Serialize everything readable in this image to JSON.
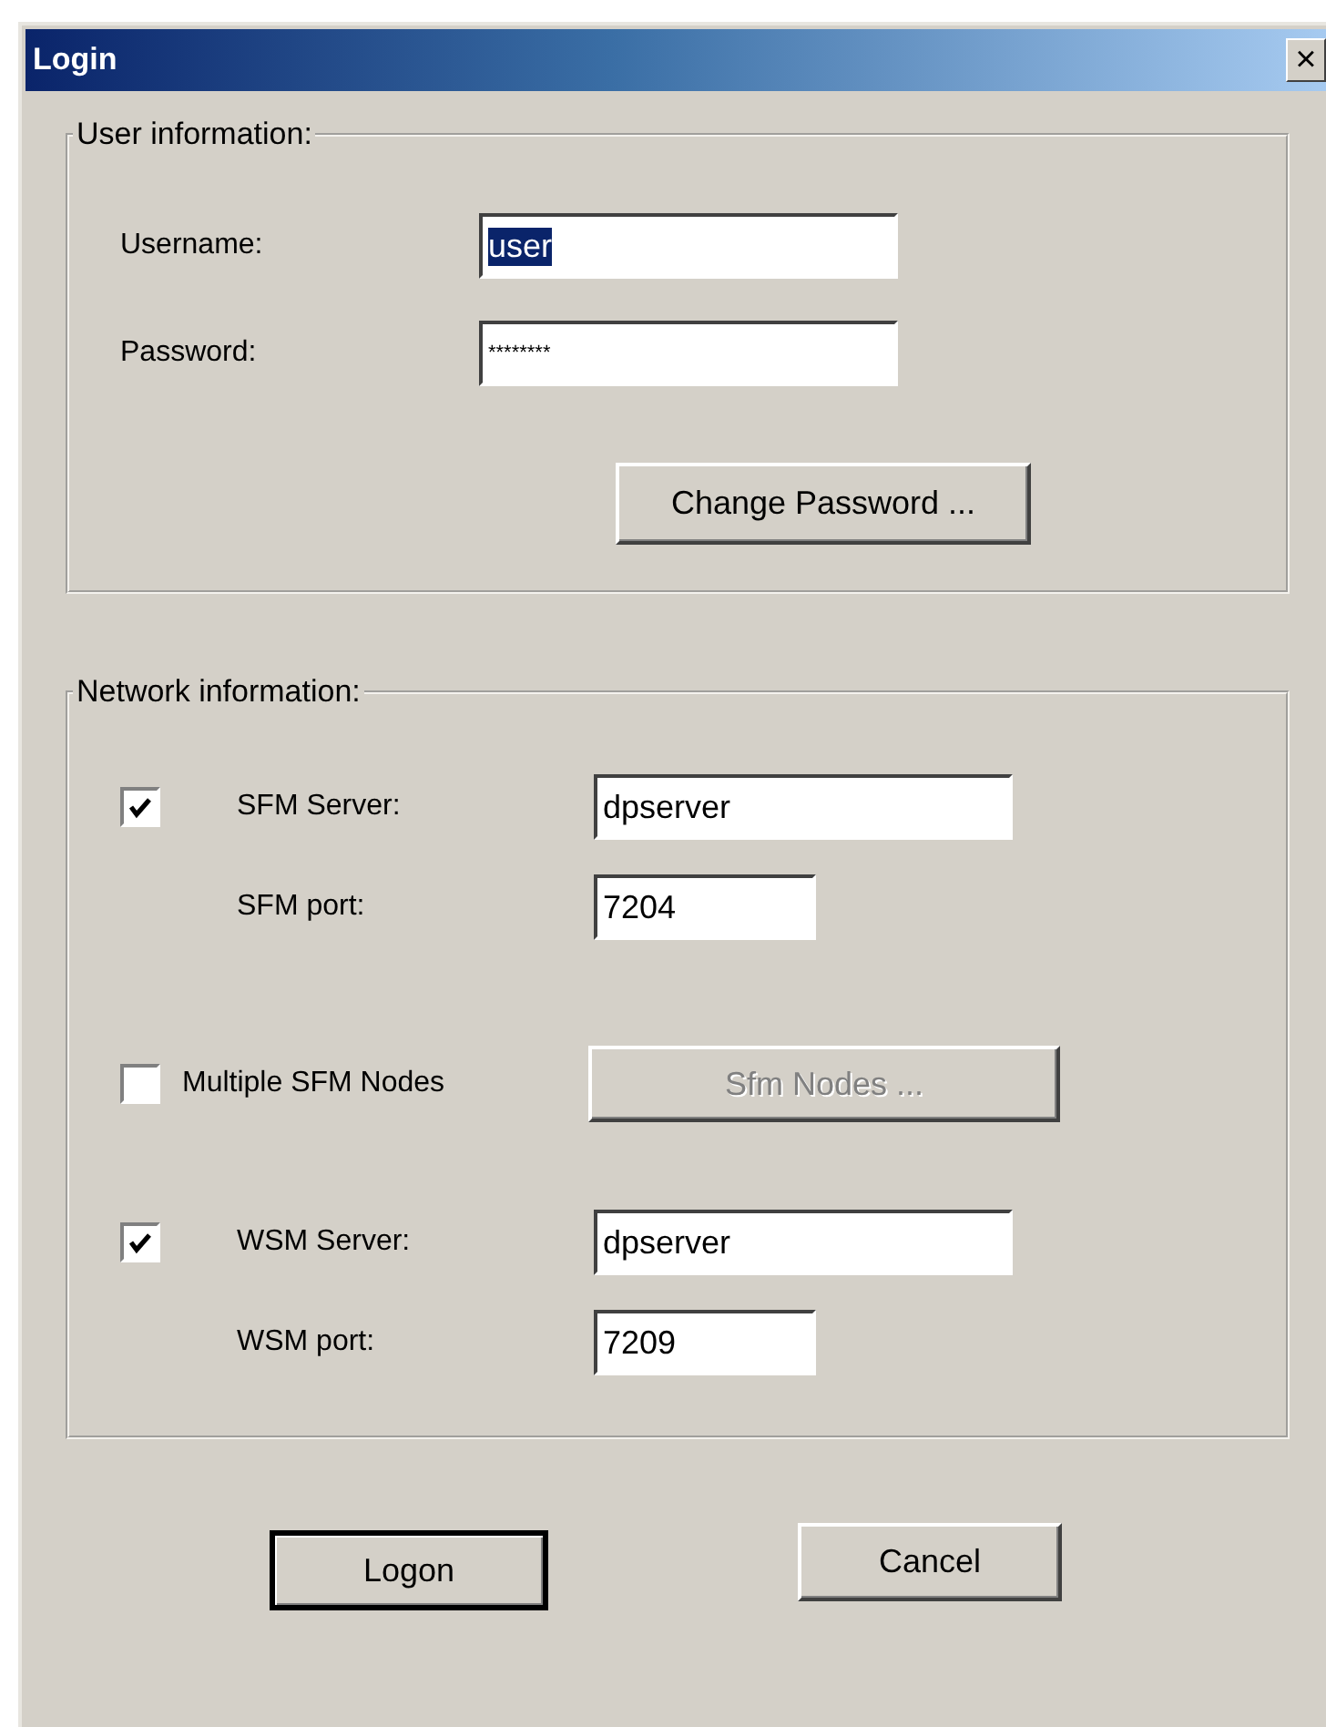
{
  "window": {
    "title": "Login",
    "close": "×"
  },
  "user_info": {
    "legend": "User information:",
    "fields": [
      {
        "label": "Username:",
        "value": "user",
        "text_selected": true
      },
      {
        "label": "Password:",
        "value": "********",
        "text_selected": false
      }
    ],
    "button": {
      "label": "Change Password ...",
      "disabled": false
    }
  },
  "network_info": {
    "legend": "Network information:",
    "rows": [
      {
        "kind": "checkbox_field",
        "checked": true,
        "label": "SFM Server:",
        "value": "dpserver",
        "wide": true
      },
      {
        "kind": "field",
        "label": "SFM port:",
        "value": "7204",
        "wide": false
      },
      {
        "kind": "checkbox_button",
        "checked": false,
        "label": "Multiple SFM Nodes",
        "button": "Sfm Nodes ...",
        "disabled": true
      },
      {
        "kind": "checkbox_field",
        "checked": true,
        "label": "WSM Server:",
        "value": "dpserver",
        "wide": true
      },
      {
        "kind": "field",
        "label": "WSM port:",
        "value": "7209",
        "wide": false
      }
    ]
  },
  "buttons": [
    {
      "label": "Logon",
      "default": true
    },
    {
      "label": "Cancel",
      "default": false
    }
  ]
}
